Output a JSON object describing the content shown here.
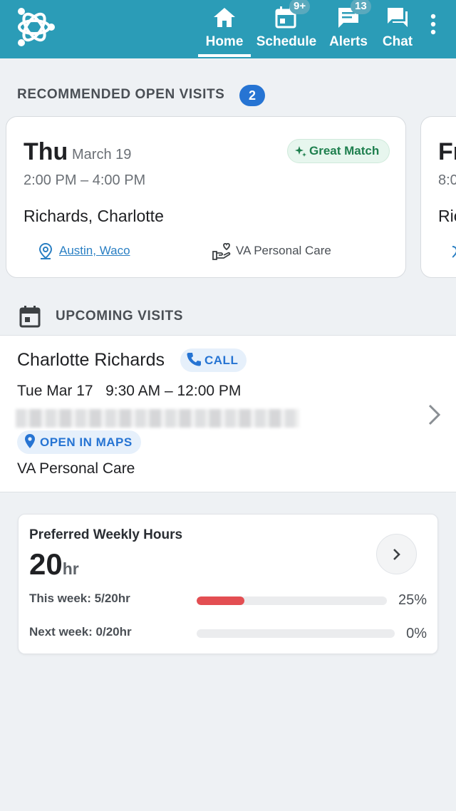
{
  "nav": {
    "items": [
      {
        "label": "Home",
        "icon": "home-icon",
        "active": true
      },
      {
        "label": "Schedule",
        "icon": "calendar-icon",
        "badge": "9+"
      },
      {
        "label": "Alerts",
        "icon": "alerts-icon",
        "badge": "13"
      },
      {
        "label": "Chat",
        "icon": "chat-icon"
      }
    ],
    "more_icon": "more-vertical-icon"
  },
  "recommended": {
    "title": "RECOMMENDED OPEN VISITS",
    "count": "2",
    "cards": [
      {
        "day": "Thu",
        "date": "March 19",
        "time": "2:00 PM – 4:00 PM",
        "client": "Richards, Charlotte",
        "match": "Great Match",
        "location": "Austin, Waco",
        "care_type": "VA Personal Care"
      },
      {
        "day": "Fr",
        "time": "8:0",
        "client": "Ric"
      }
    ]
  },
  "upcoming": {
    "title": "UPCOMING VISITS",
    "visit": {
      "name": "Charlotte Richards",
      "call_label": "CALL",
      "datetime": "Tue Mar 17   9:30 AM – 12:00 PM",
      "maps_label": "OPEN IN MAPS",
      "care_type": "VA Personal Care"
    }
  },
  "hours": {
    "title": "Preferred Weekly Hours",
    "value": "20",
    "unit": "hr",
    "this_week": {
      "label": "This week: 5/20hr",
      "percent_text": "25%",
      "fraction": 0.25
    },
    "next_week": {
      "label": "Next week: 0/20hr",
      "percent_text": "0%",
      "fraction": 0
    }
  },
  "colors": {
    "header": "#2b9cb7",
    "accent": "#2674d3",
    "match": "#1e7f4e",
    "progress": "#e34e52"
  }
}
